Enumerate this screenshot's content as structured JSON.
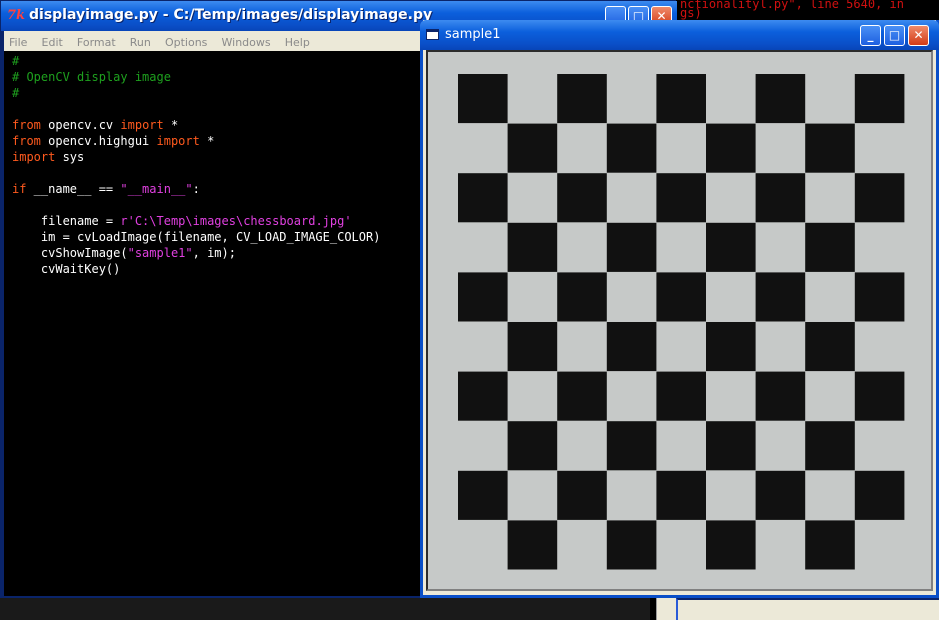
{
  "background_window": {
    "lines": [
      {
        "text": "nctionalityl.py\", line 5640, in"
      },
      {
        "text": "gs)"
      }
    ]
  },
  "editor": {
    "title_icon": "7k",
    "title": "displayimage.py - C:/Temp/images/displayimage.py",
    "buttons": {
      "minimize": "_",
      "maximize": "□",
      "close": "✕"
    },
    "menu": [
      "File",
      "Edit",
      "Format",
      "Run",
      "Options",
      "Windows",
      "Help"
    ],
    "code": [
      {
        "segments": [
          {
            "t": "#",
            "c": "comment"
          }
        ]
      },
      {
        "segments": [
          {
            "t": "# OpenCV display image",
            "c": "comment"
          }
        ]
      },
      {
        "segments": [
          {
            "t": "#",
            "c": "comment"
          }
        ]
      },
      {
        "segments": []
      },
      {
        "segments": [
          {
            "t": "from",
            "c": "kw"
          },
          {
            "t": " opencv.cv ",
            "c": "plain"
          },
          {
            "t": "import",
            "c": "kw"
          },
          {
            "t": " *",
            "c": "plain"
          }
        ]
      },
      {
        "segments": [
          {
            "t": "from",
            "c": "kw"
          },
          {
            "t": " opencv.highgui ",
            "c": "plain"
          },
          {
            "t": "import",
            "c": "kw"
          },
          {
            "t": " *",
            "c": "plain"
          }
        ]
      },
      {
        "segments": [
          {
            "t": "import",
            "c": "kw"
          },
          {
            "t": " sys",
            "c": "plain"
          }
        ]
      },
      {
        "segments": []
      },
      {
        "segments": [
          {
            "t": "if",
            "c": "kw"
          },
          {
            "t": " __name__ == ",
            "c": "plain"
          },
          {
            "t": "\"__main__\"",
            "c": "str"
          },
          {
            "t": ":",
            "c": "plain"
          }
        ]
      },
      {
        "segments": []
      },
      {
        "segments": [
          {
            "t": "    filename = ",
            "c": "plain"
          },
          {
            "t": "r'C:\\Temp\\images\\chessboard.jpg'",
            "c": "str"
          }
        ]
      },
      {
        "segments": [
          {
            "t": "    im = cvLoadImage(filename, CV_LOAD_IMAGE_COLOR)",
            "c": "plain"
          }
        ]
      },
      {
        "segments": [
          {
            "t": "    cvShowImage(",
            "c": "plain"
          },
          {
            "t": "\"sample1\"",
            "c": "str"
          },
          {
            "t": ", im);",
            "c": "plain"
          }
        ]
      },
      {
        "segments": [
          {
            "t": "    cvWaitKey()",
            "c": "plain"
          }
        ]
      }
    ]
  },
  "sample_window": {
    "title": "sample1",
    "buttons": {
      "minimize": "_",
      "maximize": "□",
      "close": "✕"
    },
    "chessboard": {
      "rows": 10,
      "cols": 9,
      "dark_color": "#111111",
      "light_color": "#c6c9c8"
    }
  }
}
